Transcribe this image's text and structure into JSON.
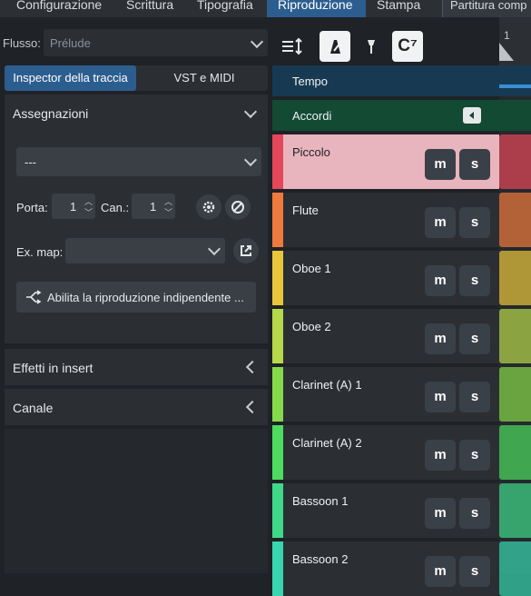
{
  "menu_tabs": [
    "Configurazione",
    "Scrittura",
    "Tipografia",
    "Riproduzione",
    "Stampa"
  ],
  "score_selector": "Partitura comp",
  "flow": {
    "label": "Flusso:",
    "value": "Prélude"
  },
  "inspector_tabs": {
    "active": "Inspector della traccia",
    "other": "VST e MIDI"
  },
  "assignments": {
    "title": "Assegnazioni",
    "device_value": "---",
    "port_label": "Porta:",
    "port_value": "1",
    "channel_label": "Can.:",
    "channel_value": "1",
    "expression_map_label": "Ex. map:",
    "independent_playback_label": "Abilita la riproduzione indipendente ..."
  },
  "inserts": {
    "title": "Effetti in insert"
  },
  "channel": {
    "title": "Canale"
  },
  "toolbar": {
    "chord_label": "C⁷"
  },
  "tracks": {
    "tempo": "Tempo",
    "chords": "Accordi",
    "instruments": [
      {
        "name": "Piccolo",
        "color": "#e5475a"
      },
      {
        "name": "Flute",
        "color": "#ef7a3d"
      },
      {
        "name": "Oboe 1",
        "color": "#e9c53a"
      },
      {
        "name": "Oboe 2",
        "color": "#b6d94a"
      },
      {
        "name": "Clarinet (A) 1",
        "color": "#86d94a"
      },
      {
        "name": "Clarinet (A) 2",
        "color": "#4ddc60"
      },
      {
        "name": "Bassoon 1",
        "color": "#3fd98a"
      },
      {
        "name": "Bassoon 2",
        "color": "#38d6b0"
      }
    ],
    "mute_label": "m",
    "solo_label": "s"
  },
  "ruler": {
    "bar_number": "1"
  },
  "colors": {
    "accent": "#2c5d8f",
    "tempo_bg": "#173a52",
    "chords_bg": "#124a34",
    "selected_track_bg": "#e8b4bd"
  }
}
